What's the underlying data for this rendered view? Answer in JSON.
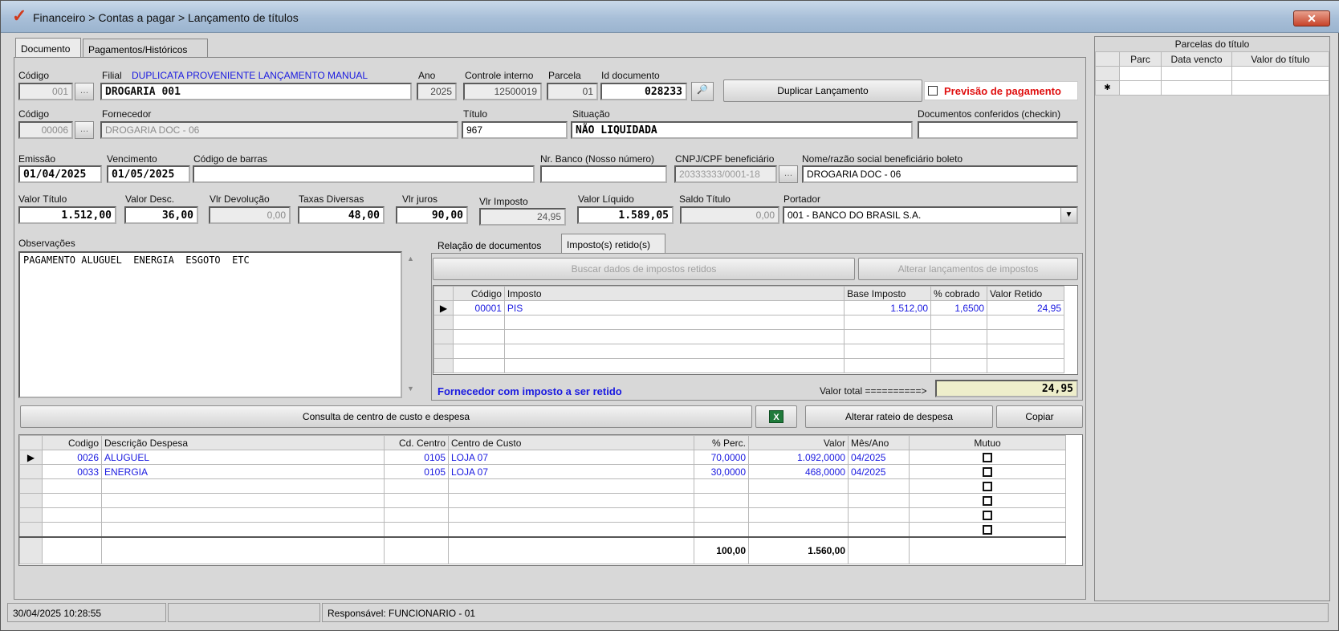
{
  "window": {
    "title": "Financeiro > Contas a pagar > Lançamento de títulos",
    "close_label": "✕"
  },
  "tabs": [
    "Documento",
    "Pagamentos/Históricos"
  ],
  "filial": {
    "codigo_label": "Código",
    "codigo": "001",
    "filial_label": "Filial",
    "filial_desc": "DUPLICATA PROVENIENTE LANÇAMENTO MANUAL",
    "filial_value": "DROGARIA 001",
    "ano_label": "Ano",
    "ano": "2025",
    "controle_label": "Controle interno",
    "controle": "12500019",
    "parcela_label": "Parcela",
    "parcela": "01",
    "id_label": "Id documento",
    "id": "028233",
    "duplicar_label": "Duplicar Lançamento",
    "previsao_label": "Previsão de pagamento"
  },
  "fornecedor": {
    "codigo_label": "Código",
    "codigo": "00006",
    "label": "Fornecedor",
    "value": "DROGARIA DOC - 06",
    "titulo_label": "Título",
    "titulo": "967",
    "situacao_label": "Situação",
    "situacao": "NÃO LIQUIDADA",
    "checkin_label": "Documentos conferidos (checkin)",
    "checkin": ""
  },
  "datas": {
    "emissao_label": "Emissão",
    "emissao": "01/04/2025",
    "vencimento_label": "Vencimento",
    "vencimento": "01/05/2025",
    "barras_label": "Código de barras",
    "barras": "",
    "banco_label": "Nr. Banco (Nosso número)",
    "banco": "",
    "cnpj_label": "CNPJ/CPF beneficiário",
    "cnpj": "20333333/0001-18",
    "nome_label": "Nome/razão social beneficiário boleto",
    "nome": "DROGARIA DOC - 06"
  },
  "valores": {
    "valor_titulo_label": "Valor Título",
    "valor_titulo": "1.512,00",
    "valor_desc_label": "Valor Desc.",
    "valor_desc": "36,00",
    "devolucao_label": "Vlr Devolução",
    "devolucao": "0,00",
    "taxas_label": "Taxas Diversas",
    "taxas": "48,00",
    "juros_label": "Vlr juros",
    "juros": "90,00",
    "imposto_label": "Vlr Imposto",
    "imposto": "24,95",
    "liquido_label": "Valor Líquido",
    "liquido": "1.589,05",
    "saldo_label": "Saldo Título",
    "saldo": "0,00",
    "portador_label": "Portador",
    "portador": "001 - BANCO DO BRASIL S.A."
  },
  "observacoes": {
    "label": "Observações",
    "text": "PAGAMENTO ALUGUEL  ENERGIA  ESGOTO  ETC"
  },
  "impostos": {
    "tabs": [
      "Relação de documentos",
      "Imposto(s) retido(s)"
    ],
    "buscar_label": "Buscar dados de impostos retidos",
    "alterar_label": "Alterar lançamentos de impostos",
    "columns": [
      "Código",
      "Imposto",
      "Base Imposto",
      "% cobrado",
      "Valor Retido"
    ],
    "rows": [
      {
        "codigo": "00001",
        "imposto": "PIS",
        "base": "1.512,00",
        "perc": "1,6500",
        "valor": "24,95"
      }
    ],
    "aviso": "Fornecedor com imposto a ser retido",
    "total_label": "Valor total ==========>",
    "total": "24,95"
  },
  "despesas": {
    "consulta_label": "Consulta de centro de custo e despesa",
    "excel_label": "X",
    "alterar_label": "Alterar rateio de despesa",
    "copiar_label": "Copiar",
    "columns": [
      "Codigo",
      "Descrição Despesa",
      "Cd. Centro",
      "Centro de Custo",
      "% Perc.",
      "Valor",
      "Mês/Ano",
      "Mutuo"
    ],
    "rows": [
      {
        "codigo": "0026",
        "desc": "ALUGUEL",
        "cd": "0105",
        "centro": "LOJA 07",
        "perc": "70,0000",
        "valor": "1.092,0000",
        "mes": "04/2025"
      },
      {
        "codigo": "0033",
        "desc": "ENERGIA",
        "cd": "0105",
        "centro": "LOJA 07",
        "perc": "30,0000",
        "valor": "468,0000",
        "mes": "04/2025"
      }
    ],
    "total_perc": "100,00",
    "total_valor": "1.560,00"
  },
  "parcelas": {
    "title": "Parcelas do título",
    "columns": [
      "Parc",
      "Data vencto",
      "Valor do título"
    ],
    "new_row_marker": "✱"
  },
  "status": {
    "datetime": "30/04/2025 10:28:55",
    "middle": "",
    "responsavel": "Responsável: FUNCIONARIO - 01"
  }
}
